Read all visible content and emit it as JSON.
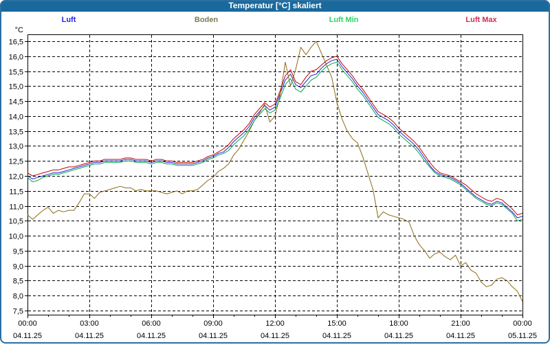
{
  "window": {
    "title": "Temperatur [°C] skaliert"
  },
  "colors": {
    "titlebar_bg": "#19699C",
    "titlebar_text": "#FFFFFF",
    "window_border": "#2B6FA3",
    "plot_background": "#FFFFFF",
    "plot_frame": "#000000",
    "gridline": "#000000",
    "tick_label": "#000000"
  },
  "legend": {
    "items": [
      {
        "label": "Luft",
        "color": "#2525E0"
      },
      {
        "label": "Boden",
        "color": "#7C7A52"
      },
      {
        "label": "Luft Min",
        "color": "#2BD465"
      },
      {
        "label": "Luft Max",
        "color": "#D22B55"
      }
    ]
  },
  "chart_data": {
    "type": "line",
    "title": "Temperatur [°C] skaliert",
    "y_unit_label": "°C",
    "ylim": [
      7.5,
      16.5
    ],
    "y_step": 0.5,
    "y_tick_labels": [
      "16,5",
      "16,0",
      "15,5",
      "15,0",
      "14,5",
      "14,0",
      "13,5",
      "13,0",
      "12,5",
      "12,0",
      "11,5",
      "11,0",
      "10,5",
      "10,0",
      "9,5",
      "9,0",
      "8,5",
      "8,0",
      "7,5"
    ],
    "x_axis": {
      "start_hour": 0,
      "end_hour": 24,
      "major_step_hours": 3,
      "minor_step_hours": 1,
      "grid": true
    },
    "x_ticks": [
      {
        "time": "00:00",
        "date": "04.11.25"
      },
      {
        "time": "03:00",
        "date": "04.11.25"
      },
      {
        "time": "06:00",
        "date": "04.11.25"
      },
      {
        "time": "09:00",
        "date": "04.11.25"
      },
      {
        "time": "12:00",
        "date": "04.11.25"
      },
      {
        "time": "15:00",
        "date": "04.11.25"
      },
      {
        "time": "18:00",
        "date": "04.11.25"
      },
      {
        "time": "21:00",
        "date": "04.11.25"
      },
      {
        "time": "00:00",
        "date": "05.11.25"
      }
    ],
    "sample_interval_minutes": 15,
    "series": [
      {
        "name": "Luft",
        "color": "#2121CE",
        "values": [
          12.0,
          11.9,
          11.95,
          12.0,
          12.05,
          12.1,
          12.1,
          12.15,
          12.2,
          12.25,
          12.3,
          12.35,
          12.4,
          12.45,
          12.45,
          12.5,
          12.5,
          12.5,
          12.5,
          12.55,
          12.55,
          12.5,
          12.5,
          12.5,
          12.45,
          12.5,
          12.5,
          12.45,
          12.45,
          12.4,
          12.4,
          12.4,
          12.4,
          12.45,
          12.5,
          12.6,
          12.65,
          12.75,
          12.8,
          12.95,
          13.15,
          13.3,
          13.45,
          13.65,
          13.95,
          14.15,
          14.35,
          14.2,
          14.3,
          14.75,
          15.2,
          15.4,
          15.05,
          14.95,
          15.15,
          15.35,
          15.4,
          15.6,
          15.75,
          15.85,
          15.9,
          15.65,
          15.45,
          15.25,
          15.0,
          14.8,
          14.55,
          14.3,
          14.05,
          13.95,
          13.85,
          13.7,
          13.5,
          13.35,
          13.2,
          13.05,
          12.85,
          12.6,
          12.35,
          12.15,
          12.05,
          12.0,
          11.95,
          11.85,
          11.75,
          11.6,
          11.45,
          11.3,
          11.2,
          11.1,
          11.05,
          11.15,
          11.1,
          10.95,
          10.8,
          10.6,
          10.65
        ]
      },
      {
        "name": "Boden",
        "color": "#8B6914",
        "values": [
          10.7,
          10.55,
          10.7,
          10.85,
          10.95,
          10.75,
          10.85,
          10.8,
          10.85,
          10.85,
          11.1,
          11.4,
          11.4,
          11.25,
          11.45,
          11.5,
          11.55,
          11.6,
          11.65,
          11.6,
          11.6,
          11.5,
          11.55,
          11.5,
          11.5,
          11.5,
          11.45,
          11.4,
          11.45,
          11.5,
          11.4,
          11.5,
          11.5,
          11.55,
          11.7,
          11.85,
          11.95,
          12.15,
          12.25,
          12.4,
          12.7,
          12.9,
          13.2,
          13.5,
          13.85,
          14.1,
          14.4,
          13.8,
          14.0,
          14.7,
          15.8,
          15.0,
          15.55,
          16.3,
          16.05,
          16.3,
          16.5,
          16.1,
          15.7,
          15.3,
          14.45,
          13.9,
          13.5,
          13.25,
          13.1,
          12.65,
          12.1,
          11.55,
          10.6,
          10.8,
          10.7,
          10.65,
          10.6,
          10.55,
          10.45,
          10.0,
          9.7,
          9.5,
          9.25,
          9.4,
          9.45,
          9.3,
          9.2,
          9.35,
          9.0,
          9.1,
          8.85,
          8.75,
          8.45,
          8.3,
          8.35,
          8.55,
          8.6,
          8.5,
          8.3,
          8.15,
          7.8
        ]
      },
      {
        "name": "Luft Min",
        "color": "#00A34D",
        "values": [
          11.95,
          11.8,
          11.85,
          11.95,
          12.0,
          12.05,
          12.05,
          12.1,
          12.15,
          12.2,
          12.25,
          12.3,
          12.35,
          12.4,
          12.4,
          12.45,
          12.45,
          12.45,
          12.45,
          12.5,
          12.5,
          12.45,
          12.45,
          12.45,
          12.4,
          12.45,
          12.45,
          12.4,
          12.4,
          12.35,
          12.35,
          12.35,
          12.35,
          12.4,
          12.45,
          12.55,
          12.6,
          12.7,
          12.75,
          12.85,
          13.05,
          13.2,
          13.35,
          13.55,
          13.85,
          14.05,
          14.25,
          14.1,
          14.2,
          14.6,
          15.05,
          15.25,
          14.9,
          14.8,
          15.0,
          15.2,
          15.3,
          15.5,
          15.65,
          15.75,
          15.8,
          15.55,
          15.35,
          15.15,
          14.9,
          14.7,
          14.45,
          14.2,
          13.95,
          13.85,
          13.75,
          13.6,
          13.4,
          13.25,
          13.1,
          12.95,
          12.75,
          12.5,
          12.3,
          12.1,
          12.0,
          11.95,
          11.9,
          11.8,
          11.7,
          11.55,
          11.4,
          11.25,
          11.15,
          11.05,
          11.0,
          11.1,
          11.05,
          10.9,
          10.75,
          10.5,
          10.55
        ]
      },
      {
        "name": "Luft Max",
        "color": "#C00000",
        "values": [
          12.1,
          12.0,
          12.05,
          12.1,
          12.15,
          12.2,
          12.2,
          12.25,
          12.3,
          12.3,
          12.35,
          12.4,
          12.45,
          12.5,
          12.5,
          12.55,
          12.55,
          12.55,
          12.55,
          12.6,
          12.6,
          12.55,
          12.55,
          12.55,
          12.5,
          12.55,
          12.55,
          12.5,
          12.5,
          12.45,
          12.45,
          12.45,
          12.45,
          12.5,
          12.55,
          12.65,
          12.7,
          12.8,
          12.9,
          13.05,
          13.25,
          13.4,
          13.55,
          13.75,
          14.05,
          14.25,
          14.45,
          14.3,
          14.4,
          14.85,
          15.35,
          15.55,
          15.15,
          15.05,
          15.3,
          15.5,
          15.55,
          15.7,
          15.85,
          15.95,
          16.0,
          15.75,
          15.55,
          15.35,
          15.1,
          14.9,
          14.65,
          14.4,
          14.15,
          14.05,
          13.95,
          13.8,
          13.6,
          13.45,
          13.3,
          13.15,
          12.95,
          12.7,
          12.45,
          12.25,
          12.1,
          12.05,
          12.0,
          11.9,
          11.8,
          11.7,
          11.55,
          11.4,
          11.3,
          11.2,
          11.15,
          11.25,
          11.2,
          11.05,
          10.9,
          10.7,
          10.75
        ]
      }
    ],
    "legend_position": "top",
    "grid": true
  }
}
